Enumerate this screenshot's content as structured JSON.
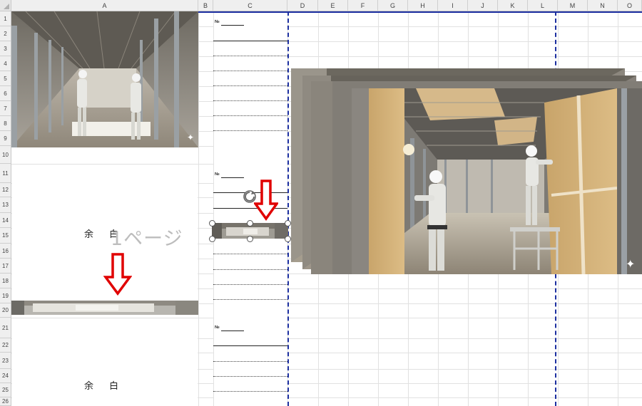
{
  "columns": [
    "A",
    "B",
    "C",
    "D",
    "E",
    "F",
    "G",
    "H",
    "I",
    "J",
    "K",
    "L",
    "M",
    "N",
    "O"
  ],
  "rows": [
    "1",
    "2",
    "3",
    "4",
    "5",
    "6",
    "7",
    "8",
    "9",
    "10",
    "11",
    "12",
    "13",
    "14",
    "15",
    "16",
    "17",
    "18",
    "19",
    "20",
    "21",
    "22",
    "23",
    "24",
    "25",
    "26"
  ],
  "number_mark": "№",
  "blank_text": "余白",
  "page_watermark": "1ページ",
  "colors": {
    "page_break": "#1c2fa0",
    "arrow": "#e00000",
    "grid": "#e1e1e1"
  }
}
